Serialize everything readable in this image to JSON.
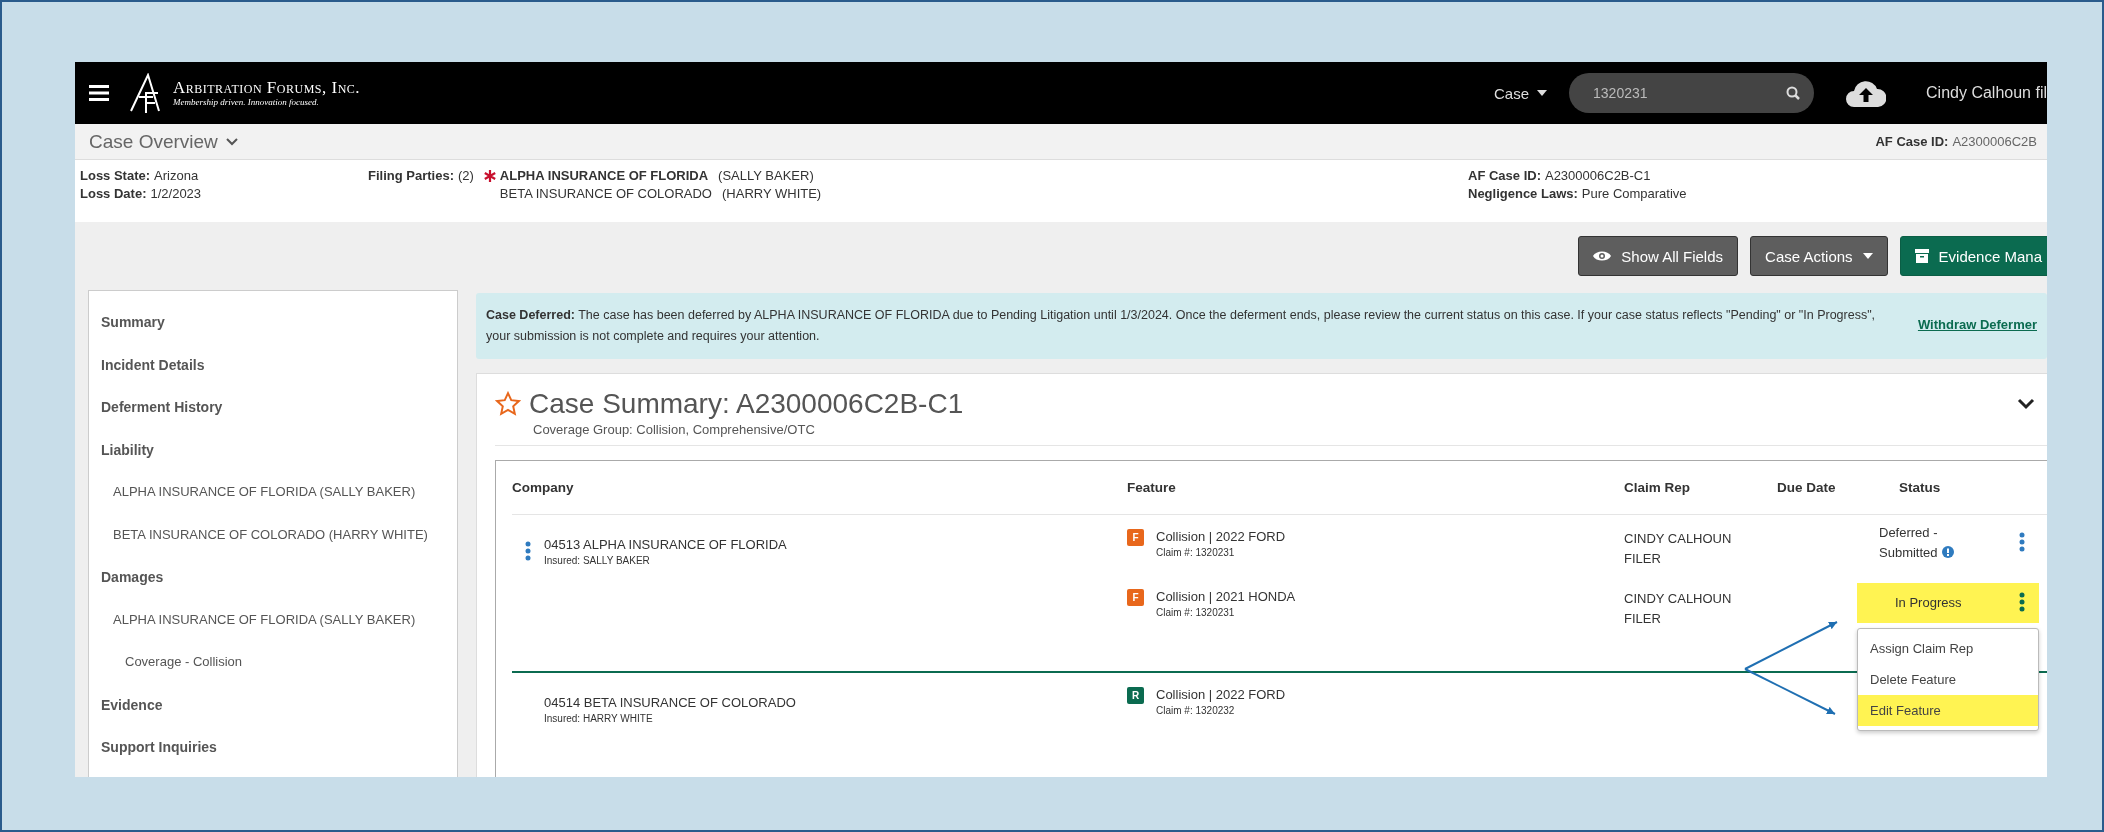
{
  "header": {
    "brand": "Arbitration Forums, Inc.",
    "tagline": "Membership driven. Innovation focused.",
    "search_scope": "Case",
    "search_value": "1320231",
    "user": "Cindy Calhoun fil"
  },
  "case_overview": {
    "title": "Case Overview",
    "case_id_label": "AF Case ID:",
    "case_id": "A2300006C2B"
  },
  "info": {
    "loss_state_label": "Loss State:",
    "loss_state": "Arizona",
    "loss_date_label": "Loss Date:",
    "loss_date": "1/2/2023",
    "filing_label": "Filing Parties:",
    "filing_count": "(2)",
    "parties": [
      {
        "name": "ALPHA INSURANCE OF FLORIDA",
        "person": "(SALLY BAKER)",
        "primary": true
      },
      {
        "name": "BETA INSURANCE OF COLORADO",
        "person": "(HARRY WHITE)",
        "primary": false
      }
    ],
    "case_id_label": "AF Case ID:",
    "case_id": "A2300006C2B-C1",
    "negligence_label": "Negligence Laws:",
    "negligence": "Pure Comparative"
  },
  "actions": [
    {
      "label": "Show All Fields",
      "kind": "eye"
    },
    {
      "label": "Case Actions",
      "kind": "dropdown"
    },
    {
      "label": "Evidence Mana",
      "kind": "archive"
    }
  ],
  "sidebar": {
    "items": [
      {
        "label": "Summary"
      },
      {
        "label": "Incident Details"
      },
      {
        "label": "Deferment History"
      },
      {
        "label": "Liability",
        "children": [
          {
            "label": "ALPHA INSURANCE OF FLORIDA (SALLY BAKER)"
          },
          {
            "label": "BETA INSURANCE OF COLORADO (HARRY WHITE)"
          }
        ]
      },
      {
        "label": "Damages",
        "children": [
          {
            "label": "ALPHA INSURANCE OF FLORIDA (SALLY BAKER)",
            "children": [
              {
                "label": "Coverage - Collision"
              }
            ]
          }
        ]
      },
      {
        "label": "Evidence"
      },
      {
        "label": "Support Inquiries"
      }
    ]
  },
  "alert": {
    "text": "**Case Deferred:** The case has been deferred by ALPHA INSURANCE OF FLORIDA due to Pending Litigation until 1/3/2024. Once the deferment ends, please review the current status on this case. If your case status reflects \"Pending\" or \"In Progress\", your submission is not complete and requires your attention.",
    "link": "Withdraw Defermer"
  },
  "summary": {
    "title": "Case Summary: A2300006C2B-C1",
    "coverage": "Coverage Group: Collision, Comprehensive/OTC",
    "starred": false,
    "expanded": true
  },
  "table": {
    "columns": [
      "Company",
      "Feature",
      "Claim Rep",
      "Due Date",
      "Status"
    ],
    "groups": [
      {
        "company": "04513 ALPHA INSURANCE OF FLORIDA",
        "insured": "Insured: SALLY BAKER",
        "has_menu": true,
        "features": [
          {
            "badge": "F",
            "color": "#e8671c",
            "feature": "Collision | 2022 FORD",
            "claim": "Claim #: 1320231",
            "claim_rep": "CINDY CALHOUN FILER",
            "status": "Deferred - Submitted",
            "status_info": true,
            "highlighted": false
          },
          {
            "badge": "F",
            "color": "#e8671c",
            "feature": "Collision | 2021 HONDA",
            "claim": "Claim #: 1320231",
            "claim_rep": "CINDY CALHOUN FILER",
            "status": "In Progress",
            "status_info": false,
            "highlighted": true,
            "menu": [
              {
                "label": "Assign Claim Rep",
                "selected": false
              },
              {
                "label": "Delete Feature",
                "selected": false
              },
              {
                "label": "Edit Feature",
                "selected": true
              }
            ]
          }
        ]
      },
      {
        "company": "04514 BETA INSURANCE OF COLORADO",
        "insured": "Insured: HARRY WHITE",
        "has_menu": false,
        "features": [
          {
            "badge": "R",
            "color": "#0b6b50",
            "feature": "Collision | 2022 FORD",
            "claim": "Claim #: 1320232"
          }
        ]
      }
    ]
  }
}
